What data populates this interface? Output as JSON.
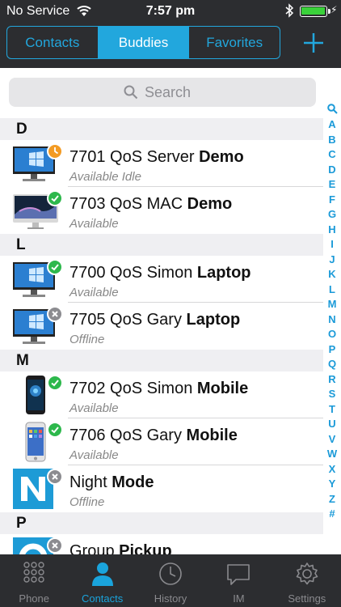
{
  "status_bar": {
    "carrier": "No Service",
    "time": "7:57 pm"
  },
  "header": {
    "tabs": [
      {
        "label": "Contacts",
        "active": false
      },
      {
        "label": "Buddies",
        "active": true
      },
      {
        "label": "Favorites",
        "active": false
      }
    ],
    "add_icon": "plus-icon"
  },
  "search": {
    "placeholder": "Search"
  },
  "sections": [
    {
      "letter": "D",
      "rows": [
        {
          "name": "7701 QoS Server ",
          "name_bold": "Demo",
          "status": "Available Idle",
          "device": "desktop-monitor",
          "badge": "idle"
        },
        {
          "name": "7703 QoS MAC ",
          "name_bold": "Demo",
          "status": "Available",
          "device": "imac",
          "badge": "available"
        }
      ]
    },
    {
      "letter": "L",
      "rows": [
        {
          "name": "7700 QoS Simon ",
          "name_bold": "Laptop",
          "status": "Available",
          "device": "desktop-monitor",
          "badge": "available"
        },
        {
          "name": "7705 QoS Gary ",
          "name_bold": "Laptop",
          "status": "Offline",
          "device": "desktop-monitor",
          "badge": "offline"
        }
      ]
    },
    {
      "letter": "M",
      "rows": [
        {
          "name": "7702 QoS Simon ",
          "name_bold": "Mobile",
          "status": "Available",
          "device": "android-phone",
          "badge": "available"
        },
        {
          "name": "7706 QoS Gary ",
          "name_bold": "Mobile",
          "status": "Available",
          "device": "iphone",
          "badge": "available"
        },
        {
          "name": "Night ",
          "name_bold": "Mode",
          "status": "Offline",
          "device": "night-mode-logo",
          "badge": "offline"
        }
      ]
    },
    {
      "letter": "P",
      "rows": [
        {
          "name": "Group ",
          "name_bold": "Pickup",
          "status": "",
          "device": "group-pickup-logo",
          "badge": "offline"
        }
      ]
    }
  ],
  "index_letters": [
    "A",
    "B",
    "C",
    "D",
    "E",
    "F",
    "G",
    "H",
    "I",
    "J",
    "K",
    "L",
    "M",
    "N",
    "O",
    "P",
    "Q",
    "R",
    "S",
    "T",
    "U",
    "V",
    "W",
    "X",
    "Y",
    "Z",
    "#"
  ],
  "tab_bar": [
    {
      "label": "Phone",
      "icon": "keypad-icon",
      "active": false
    },
    {
      "label": "Contacts",
      "icon": "person-icon",
      "active": true
    },
    {
      "label": "History",
      "icon": "clock-icon",
      "active": false
    },
    {
      "label": "IM",
      "icon": "chat-bubble-icon",
      "active": false
    },
    {
      "label": "Settings",
      "icon": "gear-icon",
      "active": false
    }
  ],
  "colors": {
    "accent": "#22a7dd",
    "header_bg": "#2c2d30",
    "available": "#2db84c",
    "idle": "#f39b24",
    "offline": "#8c8c90"
  }
}
